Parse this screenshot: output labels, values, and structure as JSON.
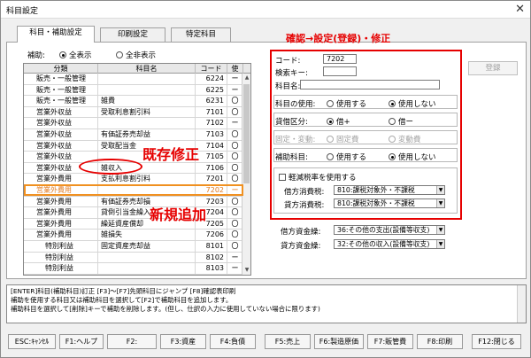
{
  "window": {
    "title": "科目設定",
    "close_glyph": "✕"
  },
  "tabs": [
    {
      "label": "科目・補助設定",
      "active": true
    },
    {
      "label": "印刷設定",
      "active": false
    },
    {
      "label": "特定科目",
      "active": false
    }
  ],
  "filter": {
    "label": "補助:",
    "options": [
      {
        "label": "全表示",
        "selected": true
      },
      {
        "label": "全非表示",
        "selected": false
      }
    ]
  },
  "grid": {
    "headers": [
      "分類",
      "科目名",
      "コード",
      "使"
    ],
    "rows": [
      {
        "category": "販売・一般管理",
        "name": "",
        "code": "6224",
        "use": "ー"
      },
      {
        "category": "販売・一般管理",
        "name": "",
        "code": "6225",
        "use": "ー"
      },
      {
        "category": "販売・一般管理",
        "name": "雑費",
        "code": "6231",
        "use": "〇"
      },
      {
        "category": "営業外収益",
        "name": "受取利息割引料",
        "code": "7101",
        "use": "〇"
      },
      {
        "category": "営業外収益",
        "name": "",
        "code": "7102",
        "use": "ー"
      },
      {
        "category": "営業外収益",
        "name": "有価証券売却益",
        "code": "7103",
        "use": "〇"
      },
      {
        "category": "営業外収益",
        "name": "受取配当金",
        "code": "7104",
        "use": "〇"
      },
      {
        "category": "営業外収益",
        "name": "",
        "code": "7105",
        "use": "〇"
      },
      {
        "category": "営業外収益",
        "name": "雑収入",
        "code": "7106",
        "use": "〇"
      },
      {
        "category": "営業外費用",
        "name": "支払利息割引料",
        "code": "7201",
        "use": "〇"
      },
      {
        "category": "営業外費用",
        "name": "",
        "code": "7202",
        "use": "ー"
      },
      {
        "category": "営業外費用",
        "name": "有価証券売却損",
        "code": "7203",
        "use": "〇"
      },
      {
        "category": "営業外費用",
        "name": "貸倒引当金繰入",
        "code": "7204",
        "use": "〇"
      },
      {
        "category": "営業外費用",
        "name": "繰延資産償却",
        "code": "7205",
        "use": "〇"
      },
      {
        "category": "営業外費用",
        "name": "雑損失",
        "code": "7206",
        "use": "〇"
      },
      {
        "category": "特別利益",
        "name": "固定資産売却益",
        "code": "8101",
        "use": "〇"
      },
      {
        "category": "特別利益",
        "name": "",
        "code": "8102",
        "use": "ー"
      },
      {
        "category": "特別利益",
        "name": "",
        "code": "8103",
        "use": "ー"
      }
    ]
  },
  "annotations": {
    "panel_title": "確認→設定(登録)・修正",
    "existing_fix": "既存修正",
    "new_add": "新規追加"
  },
  "form": {
    "code_label": "コード:",
    "code_value": "7202",
    "search_key_label": "検索キー:",
    "search_key_value": "",
    "name_label": "科目名:",
    "name_value": "",
    "use_label": "科目の使用:",
    "use_options": [
      {
        "label": "使用する",
        "selected": false
      },
      {
        "label": "使用しない",
        "selected": true
      }
    ],
    "debit_credit_label": "貸借区分:",
    "debit_credit_options": [
      {
        "label": "借+",
        "selected": true
      },
      {
        "label": "借ー",
        "selected": false
      }
    ],
    "fixed_var_label": "固定・変動:",
    "fixed_var_options": [
      {
        "label": "固定費",
        "selected": false
      },
      {
        "label": "変動費",
        "selected": false
      }
    ],
    "sub_label": "補助科目:",
    "sub_options": [
      {
        "label": "使用する",
        "selected": false
      },
      {
        "label": "使用しない",
        "selected": true
      }
    ],
    "reduced_tax_label": "軽減税率を使用する",
    "debit_tax_label": "借方消費税:",
    "debit_tax_value": "810:課税対象外・不課税",
    "credit_tax_label": "貸方消費税:",
    "credit_tax_value": "810:課税対象外・不課税",
    "debit_fund_label": "借方資金繰:",
    "debit_fund_value": "36:その他の支出(設備等収支)",
    "credit_fund_label": "貸方資金繰:",
    "credit_fund_value": "32:その他の収入(設備等収支)"
  },
  "register_button": "登録",
  "help_lines": [
    "[ENTER]科目(補助科目)訂正 [F3]〜[F7]先頭科目にジャンプ [F8]確認表印刷",
    "補助を使用する科目又は補助科目を選択して[F2]で補助科目を追加します。",
    "補助科目を選択して[削除]キーで補助を削除します。(但し、仕訳の入力に使用していない場合に限ります)"
  ],
  "fkeys": [
    {
      "label": "ESC:ｷｬﾝｾﾙ"
    },
    {
      "label": "F1:ヘルプ"
    },
    {
      "label": "F2:"
    },
    {
      "label": "F3:資産"
    },
    {
      "label": "F4:負債"
    },
    {
      "label": "F5:売上"
    },
    {
      "label": "F6:製造原価"
    },
    {
      "label": "F7:販管費"
    },
    {
      "label": "F8:印刷"
    },
    {
      "label": "F12:閉じる"
    }
  ]
}
